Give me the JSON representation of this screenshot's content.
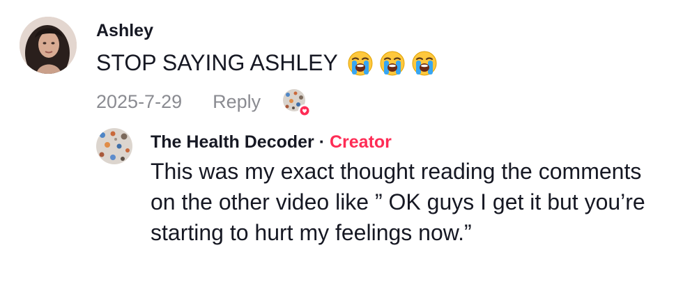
{
  "comment": {
    "username": "Ashley",
    "text": "STOP SAYING ASHLEY",
    "emojis": [
      "loudly-crying-face-emoji",
      "loudly-crying-face-emoji",
      "loudly-crying-face-emoji"
    ],
    "date": "2025-7-29",
    "reply_label": "Reply",
    "liked_by_creator": true
  },
  "reply": {
    "username": "The Health Decoder",
    "separator": " · ",
    "badge": "Creator",
    "text": "This was my exact thought reading the comments on the other video like ” OK guys I get it but you’re starting to hurt my feelings now.”"
  },
  "colors": {
    "text_primary": "#161823",
    "text_secondary": "#8a8b91",
    "creator_accent": "#fe2c55"
  }
}
